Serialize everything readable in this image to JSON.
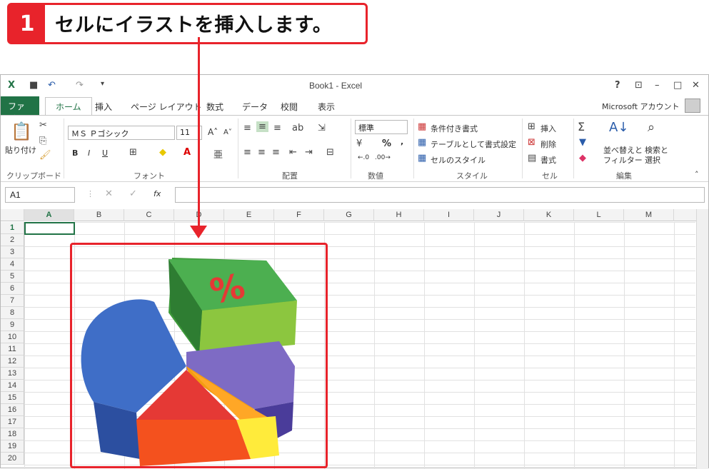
{
  "step": {
    "number": "1",
    "text": "セルにイラストを挿入します。"
  },
  "window": {
    "title": "Book1 - Excel",
    "account": "Microsoft アカウント",
    "help": "?"
  },
  "tabs": [
    "ファイル",
    "ホーム",
    "挿入",
    "ページ レイアウト",
    "数式",
    "データ",
    "校閲",
    "表示"
  ],
  "ribbon": {
    "clipboard": {
      "paste": "貼り付け",
      "label": "クリップボード"
    },
    "font": {
      "name": "ＭＳ Ｐゴシック",
      "size": "11",
      "bold": "B",
      "italic": "I",
      "underline": "U",
      "label": "フォント"
    },
    "alignment": {
      "label": "配置"
    },
    "number": {
      "format": "標準",
      "percent": "%",
      "label": "数値"
    },
    "styles": {
      "conditional": "条件付き書式",
      "table": "テーブルとして書式設定",
      "cell_styles": "セルのスタイル",
      "label": "スタイル"
    },
    "cells": {
      "insert": "挿入",
      "delete": "削除",
      "format": "書式",
      "label": "セル"
    },
    "editing": {
      "sort": "並べ替えと",
      "filter": "フィルター",
      "find": "検索と",
      "select": "選択",
      "label": "編集"
    }
  },
  "formula_bar": {
    "name_box": "A1",
    "fx": "fx",
    "value": ""
  },
  "columns": [
    "A",
    "B",
    "C",
    "D",
    "E",
    "F",
    "G",
    "H",
    "I",
    "J",
    "K",
    "L",
    "M"
  ],
  "rows": [
    "1",
    "2",
    "3",
    "4",
    "5",
    "6",
    "7",
    "8",
    "9",
    "10",
    "11",
    "12",
    "13",
    "14",
    "15",
    "16",
    "17",
    "18",
    "19",
    "20"
  ],
  "illustration": {
    "symbol": "%"
  },
  "colors": {
    "accent": "#e8232b",
    "excel_green": "#217346"
  }
}
